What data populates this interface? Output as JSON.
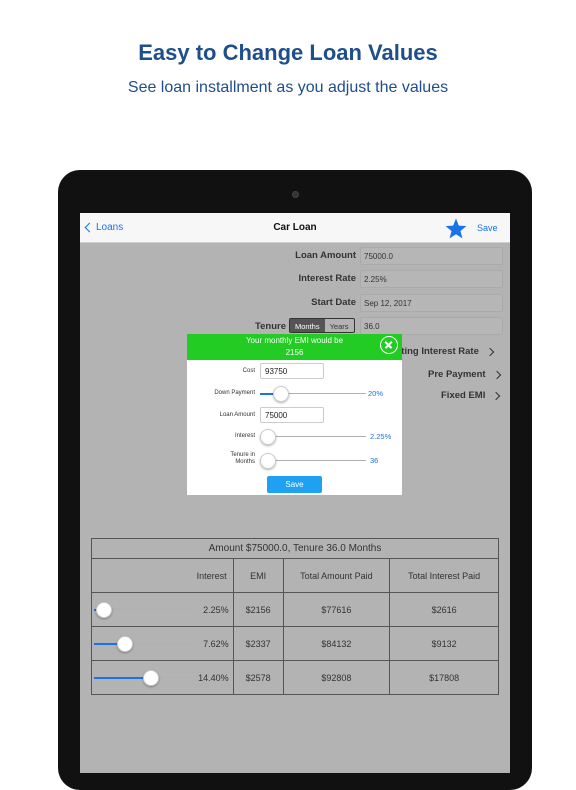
{
  "promo": {
    "title": "Easy to Change Loan Values",
    "subtitle": "See loan installment as you adjust the values"
  },
  "nav": {
    "back_label": "Loans",
    "title": "Car Loan",
    "save_label": "Save"
  },
  "form": {
    "loan_amount_label": "Loan Amount",
    "loan_amount_value": "75000.0",
    "interest_rate_label": "Interest Rate",
    "interest_rate_value": "2.25%",
    "start_date_label": "Start Date",
    "start_date_value": "Sep 12, 2017",
    "tenure_label": "Tenure",
    "tenure_months": "Months",
    "tenure_years": "Years",
    "tenure_value": "36.0",
    "floating_label": "ating Interest Rate",
    "prepayment_label": "Pre Payment",
    "fixed_emi_label": "Fixed EMI"
  },
  "modal": {
    "header_line1": "Your  monthly EMI would be",
    "header_line2": "2156",
    "cost_label": "Cost",
    "cost_value": "93750",
    "down_payment_label": "Down Payment",
    "down_payment_value": "20%",
    "down_payment_level": 0.2,
    "loan_amount_label": "Loan Amount",
    "loan_amount_value": "75000",
    "interest_label": "Interest",
    "interest_value": "2.25%",
    "interest_level": 0.08,
    "tenure_label": "Tenure in Months",
    "tenure_value": "36",
    "tenure_level": 0.08,
    "save_label": "Save"
  },
  "summary": {
    "caption": "Amount $75000.0, Tenure 36.0 Months",
    "headers": [
      "Interest",
      "EMI",
      "Total Amount Paid",
      "Total Interest Paid"
    ],
    "rows": [
      {
        "interest": "2.25%",
        "emi": "$2156",
        "total_paid": "$77616",
        "total_interest": "$2616",
        "level": 0.1
      },
      {
        "interest": "7.62%",
        "emi": "$2337",
        "total_paid": "$84132",
        "total_interest": "$9132",
        "level": 0.32
      },
      {
        "interest": "14.40%",
        "emi": "$2578",
        "total_paid": "$92808",
        "total_interest": "$17808",
        "level": 0.58
      }
    ]
  },
  "colors": {
    "title": "#1f4e8c",
    "accent": "#1a73e8",
    "emi_header": "#22cc22",
    "save_button": "#1ea1f0"
  },
  "icons": [
    "back-chevron-icon",
    "star-icon",
    "close-icon",
    "chevron-right-icon"
  ]
}
